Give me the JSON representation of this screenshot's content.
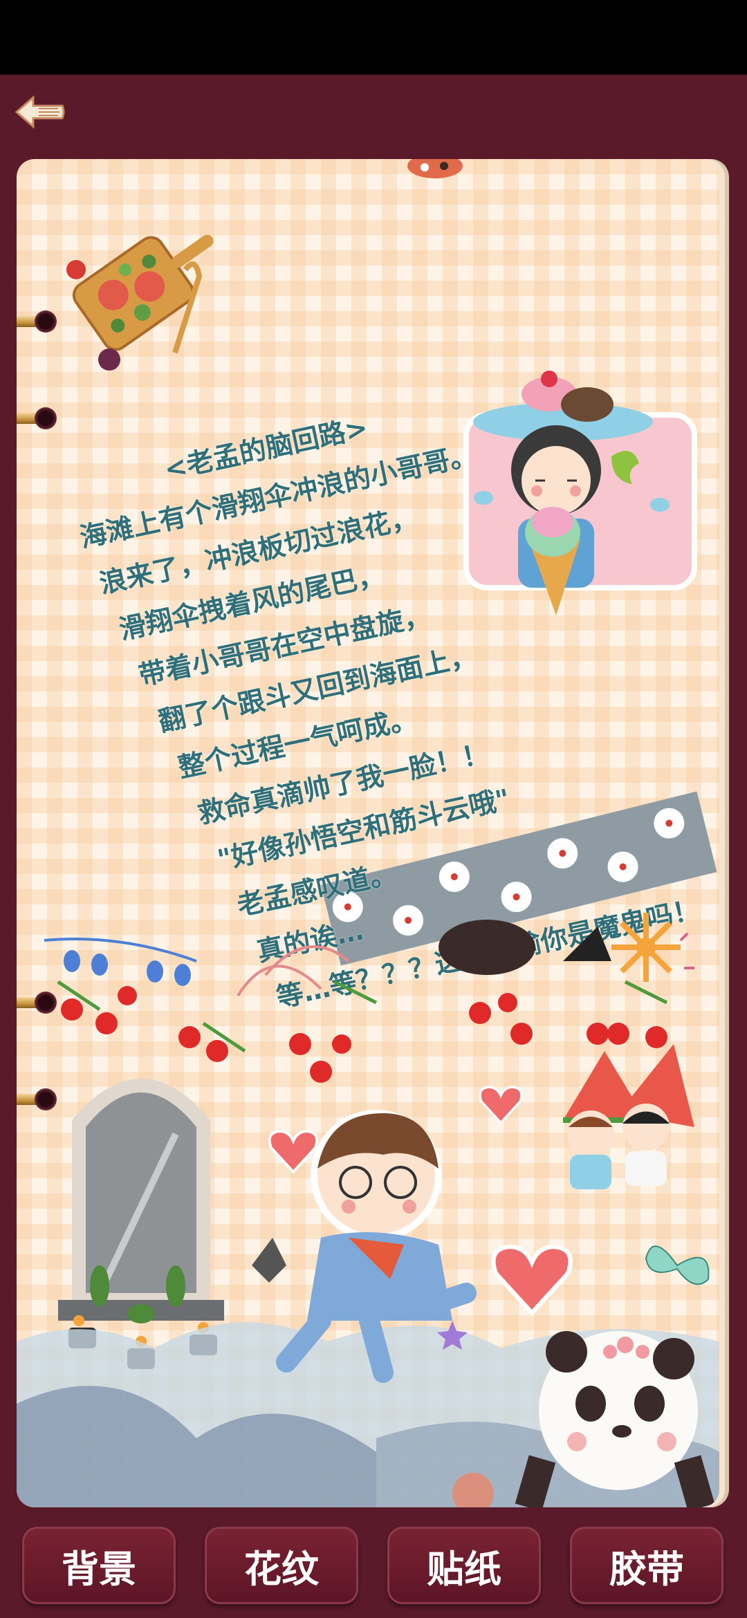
{
  "header": {
    "back_icon": "back-arrow-icon"
  },
  "poem": {
    "title": "<老孟的脑回路>",
    "lines": [
      "海滩上有个滑翔伞冲浪的小哥哥。",
      "浪来了，冲浪板切过浪花，",
      "滑翔伞拽着风的尾巴，",
      "带着小哥哥在空中盘旋，",
      "翻了个跟斗又回到海面上，",
      "整个过程一气呵成。",
      "救命真滴帅了我一脸！！",
      "\"好像孙悟空和筋斗云哦\"",
      "老孟感叹道。",
      "真的诶…",
      "等…等？？？这个比喻你是魔鬼吗！"
    ]
  },
  "toolbar": {
    "tabs": [
      {
        "label": "背景"
      },
      {
        "label": "花纹"
      },
      {
        "label": "贴纸"
      },
      {
        "label": "胶带"
      }
    ]
  },
  "colors": {
    "frame": "#5a1a2a",
    "text": "#2f6f79",
    "page": "#fdf3e6"
  }
}
